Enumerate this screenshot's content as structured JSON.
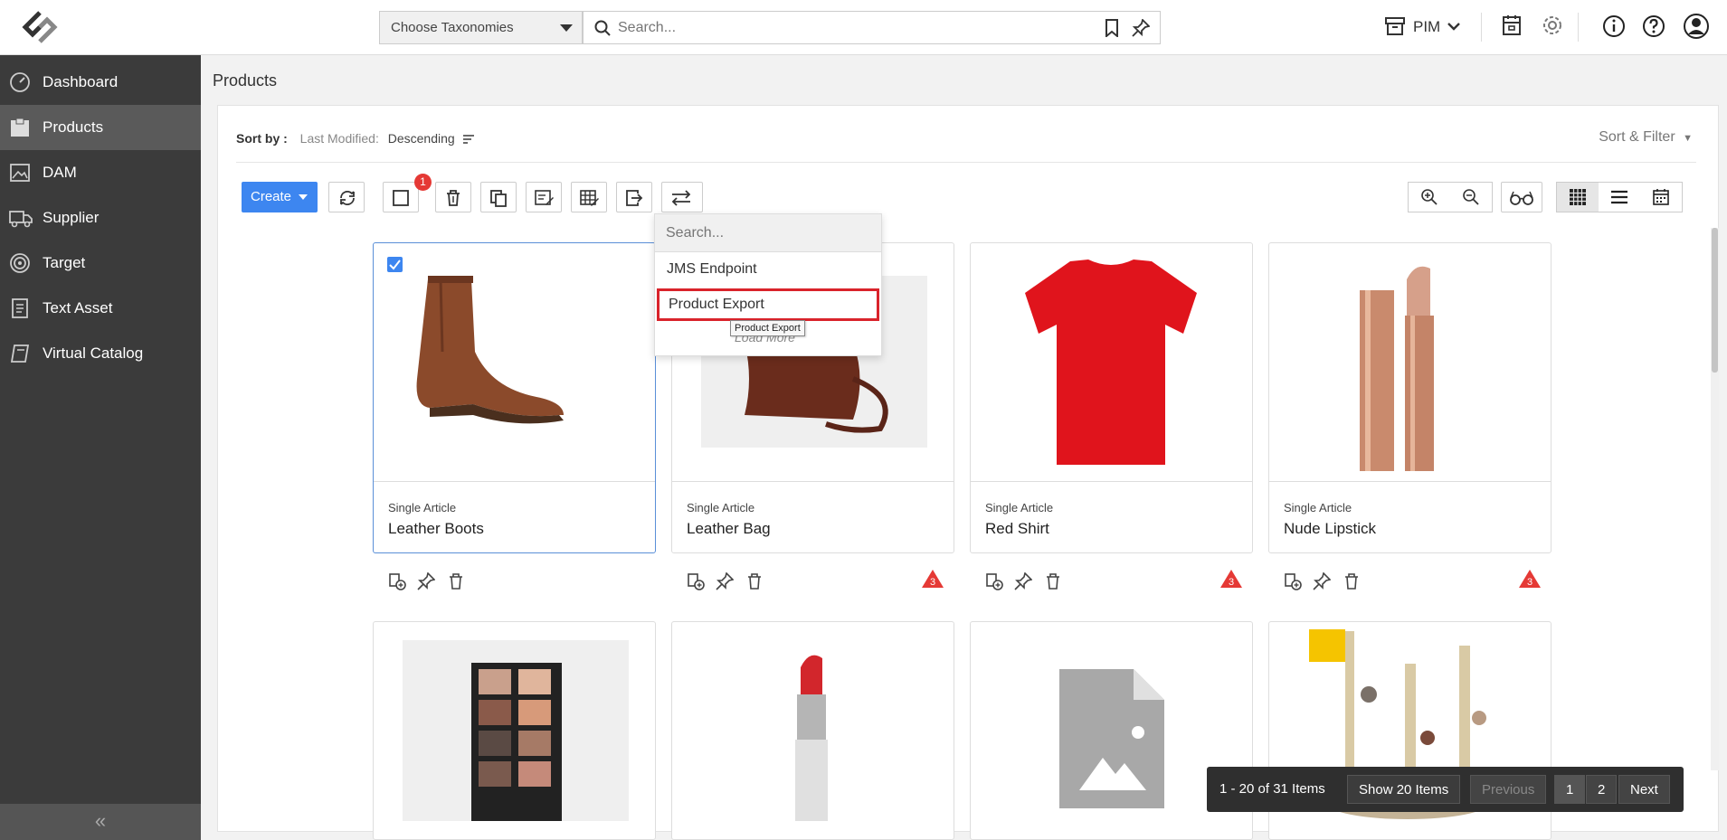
{
  "header": {
    "taxonomy_label": "Choose Taxonomies",
    "search_placeholder": "Search...",
    "app_switch": "PIM"
  },
  "sidebar": {
    "items": [
      {
        "label": "Dashboard"
      },
      {
        "label": "Products"
      },
      {
        "label": "DAM"
      },
      {
        "label": "Supplier"
      },
      {
        "label": "Target"
      },
      {
        "label": "Text Asset"
      },
      {
        "label": "Virtual Catalog"
      }
    ],
    "collapse_glyph": "«"
  },
  "page": {
    "title": "Products",
    "sort_by_label": "Sort by :",
    "sort_field": "Last Modified:",
    "sort_order": "Descending",
    "sort_filter_label": "Sort & Filter"
  },
  "toolbar": {
    "create_label": "Create",
    "selected_badge": "1"
  },
  "dropdown": {
    "search_placeholder": "Search...",
    "options": [
      "JMS Endpoint",
      "Product Export"
    ],
    "load_more": "Load More",
    "tooltip": "Product Export"
  },
  "products": [
    {
      "type": "Single Article",
      "name": "Leather Boots",
      "warnings": ""
    },
    {
      "type": "Single Article",
      "name": "Leather Bag",
      "warnings": "3"
    },
    {
      "type": "Single Article",
      "name": "Red Shirt",
      "warnings": "3"
    },
    {
      "type": "Single Article",
      "name": "Nude Lipstick",
      "warnings": "3"
    }
  ],
  "pagination": {
    "range_text": "1 - 20 of 31 Items",
    "page_size": "Show 20 Items",
    "previous": "Previous",
    "pages": [
      "1",
      "2"
    ],
    "next": "Next"
  },
  "colors": {
    "sidebar_bg": "#3b3b3b",
    "accent": "#3d86f0",
    "highlight_border": "#d9232b",
    "warning": "#e53935"
  }
}
